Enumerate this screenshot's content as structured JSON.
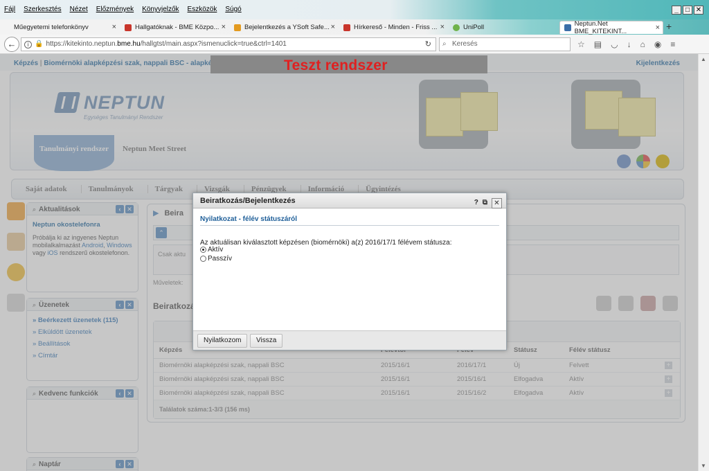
{
  "browser": {
    "menu": [
      "Fájl",
      "Szerkesztés",
      "Nézet",
      "Előzmények",
      "Könyvjelzők",
      "Eszközök",
      "Súgó"
    ],
    "tabs": [
      {
        "label": "Műegyetemi telefonkönyv",
        "color": ""
      },
      {
        "label": "Hallgatóknak - BME Közpo...",
        "color": "#c8352b"
      },
      {
        "label": "Bejelentkezés a YSoft Safe...",
        "color": "#e39a1f"
      },
      {
        "label": "Hírkereső - Minden - Friss ...",
        "color": "#c8352b"
      },
      {
        "label": "UniPoll",
        "color": "#6fb24b"
      },
      {
        "label": "Neptun.Net BME_KITEKINT...",
        "color": "#3b6ea8"
      }
    ],
    "url_prefix": "https://kitekinto.neptun.",
    "url_host": "bme.hu",
    "url_suffix": "/hallgtst/main.aspx?ismenuclick=true&ctrl=1401",
    "search_placeholder": "Keresés"
  },
  "page": {
    "breadcrumb_prefix": "Képzés",
    "breadcrumb_text": "Biomérnöki alapképzési szak, nappali BSC - alapképzés (BA/BSc)(Fe",
    "test_banner": "Teszt rendszer",
    "logout": "Kijelentkezés",
    "logo_word": "NEPTUN",
    "logo_sub": "Egységes Tanulmányi Rendszer",
    "header_tab_active": "Tanulmányi rendszer",
    "header_tab_2": "Neptun Meet Street",
    "nav": [
      "Saját adatok",
      "Tanulmányok",
      "Tárgyak",
      "Vizsgák",
      "Pénzügyek",
      "Információ",
      "Ügyintézés"
    ],
    "boxes": {
      "news": {
        "title": "Aktualitások",
        "headline": "Neptun okostelefonra",
        "text_1": "Próbálja ki az ingyenes Neptun mobilalkalmazást",
        "link_android": "Android",
        "text_2": ",",
        "link_windows": "Windows",
        "text_3": "vagy",
        "link_ios": "iOS",
        "text_4": "rendszerű okostelefonon."
      },
      "messages": {
        "title": "Üzenetek",
        "items": [
          "Beérkezett üzenetek (115)",
          "Elküldött üzenetek",
          "Beállítások",
          "Címtár"
        ]
      },
      "favorites": {
        "title": "Kedvenc funkciók"
      },
      "calendar": {
        "title": "Naptár"
      }
    },
    "panel": {
      "title": "Beira",
      "filter_text": "Csak aktu",
      "ops_label": "Műveletek:",
      "subtitle": "Beiratkozá",
      "grid": {
        "headers": [
          "Képzés",
          "Félévtől",
          "Félév",
          "Státusz",
          "Félév státusz",
          ""
        ],
        "rows": [
          [
            "Biomérnöki alapképzési szak, nappali BSC",
            "2015/16/1",
            "2016/17/1",
            "Új",
            "Felvett"
          ],
          [
            "Biomérnöki alapképzési szak, nappali BSC",
            "2015/16/1",
            "2015/16/1",
            "Elfogadva",
            "Aktív"
          ],
          [
            "Biomérnöki alapképzési szak, nappali BSC",
            "2015/16/1",
            "2015/16/2",
            "Elfogadva",
            "Aktív"
          ]
        ],
        "footer": "Találatok száma:1-3/3 (156 ms)"
      }
    }
  },
  "modal": {
    "title": "Beiratkozás/Bejelentkezés",
    "help": "?",
    "subtitle": "Nyilatkozat - félév státuszáról",
    "question": "Az aktuálisan kiválasztott képzésen (biomérnöki) a(z) 2016/17/1 félévem státusza:",
    "options": [
      {
        "label": "Aktív",
        "selected": true
      },
      {
        "label": "Passzív",
        "selected": false
      }
    ],
    "buttons": {
      "confirm": "Nyilatkozom",
      "back": "Vissza"
    }
  }
}
